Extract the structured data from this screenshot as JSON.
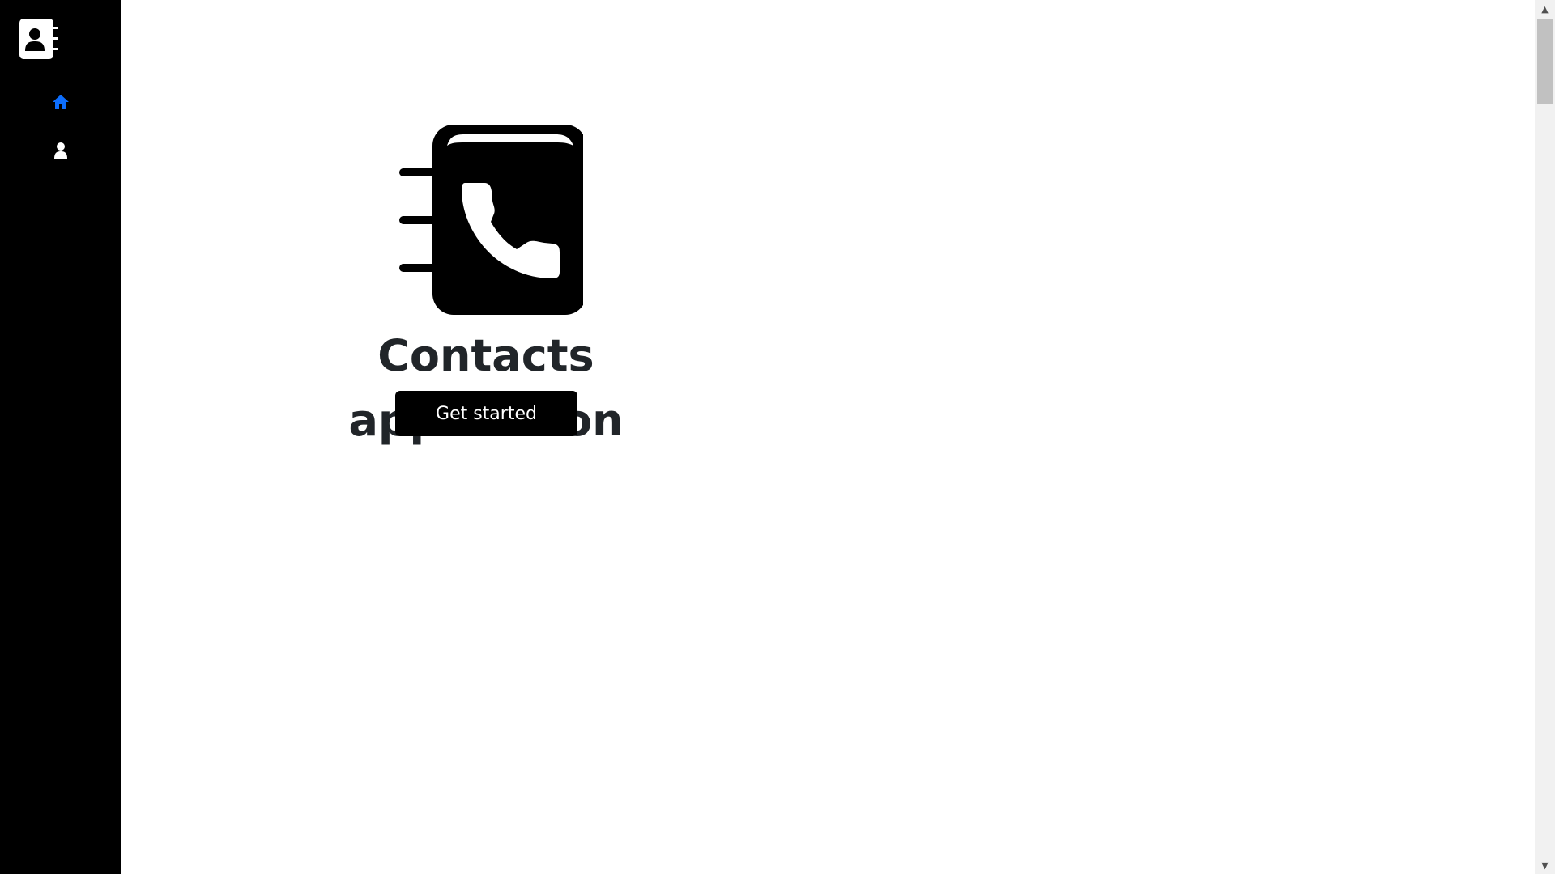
{
  "sidebar": {
    "logo_icon": "contact-book-icon",
    "nav": [
      {
        "icon": "home-icon",
        "color": "#0d6efd",
        "active": true
      },
      {
        "icon": "user-icon",
        "color": "#ffffff",
        "active": false
      }
    ],
    "background": "#000000"
  },
  "main": {
    "hero_icon": "phone-book-icon",
    "title": "Contacts application",
    "cta_label": "Get started",
    "title_color": "#212529"
  },
  "scrollbar": {
    "up_arrow": "▲",
    "down_arrow": "▼"
  }
}
